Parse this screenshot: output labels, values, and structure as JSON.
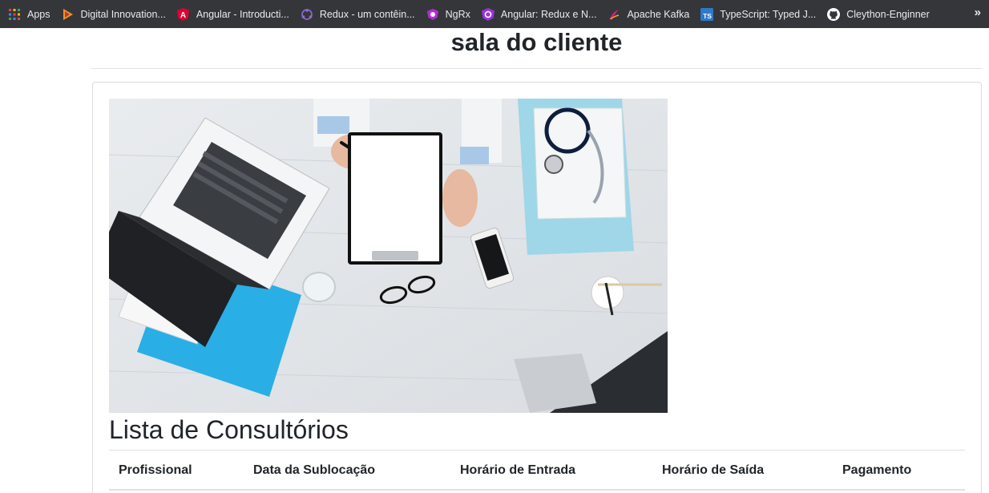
{
  "bookmarks": {
    "items": [
      {
        "label": "Apps",
        "icon": "apps-grid-icon"
      },
      {
        "label": "Digital Innovation...",
        "icon": "dio-icon"
      },
      {
        "label": "Angular - Introducti...",
        "icon": "angular-icon"
      },
      {
        "label": "Redux - um contêin...",
        "icon": "redux-icon"
      },
      {
        "label": "NgRx",
        "icon": "ngrx-icon"
      },
      {
        "label": "Angular: Redux e N...",
        "icon": "ngrx-icon"
      },
      {
        "label": "Apache Kafka",
        "icon": "kafka-icon"
      },
      {
        "label": "TypeScript: Typed J...",
        "icon": "typescript-icon"
      },
      {
        "label": "Cleython-Enginner",
        "icon": "github-icon"
      }
    ],
    "more_label": "»"
  },
  "page": {
    "title": "sala do cliente"
  },
  "main": {
    "hero_alt": "",
    "list_title": "Lista de Consultórios",
    "table": {
      "columns": [
        "Profissional",
        "Data da Sublocação",
        "Horário de Entrada",
        "Horário de Saída",
        "Pagamento"
      ]
    }
  },
  "colors": {
    "bookmarks_bg": "#35363a",
    "bookmarks_text": "#e8eaed",
    "angular": "#dd0031",
    "typescript": "#3178c6",
    "accent_cyan": "#29aee6"
  }
}
